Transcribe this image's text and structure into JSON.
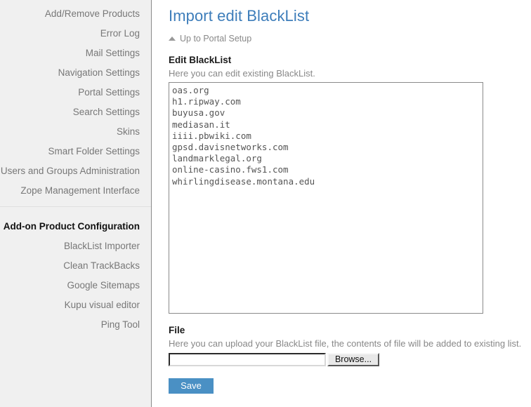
{
  "sidebar": {
    "sections": [
      {
        "name": "portal-setup-links",
        "items": [
          {
            "label": "Add/Remove Products",
            "current": false
          },
          {
            "label": "Error Log",
            "current": false
          },
          {
            "label": "Mail Settings",
            "current": false
          },
          {
            "label": "Navigation Settings",
            "current": false
          },
          {
            "label": "Portal Settings",
            "current": false
          },
          {
            "label": "Search Settings",
            "current": false
          },
          {
            "label": "Skins",
            "current": false
          },
          {
            "label": "Smart Folder Settings",
            "current": false
          },
          {
            "label": "Users and Groups Administration",
            "current": false
          },
          {
            "label": "Zope Management Interface",
            "current": false
          }
        ]
      },
      {
        "name": "addon-product-configuration",
        "items": [
          {
            "label": "Add-on Product Configuration",
            "current": true
          },
          {
            "label": "BlackList Importer",
            "current": false
          },
          {
            "label": "Clean TrackBacks",
            "current": false
          },
          {
            "label": "Google Sitemaps",
            "current": false
          },
          {
            "label": "Kupu visual editor",
            "current": false
          },
          {
            "label": "Ping Tool",
            "current": false
          }
        ]
      }
    ]
  },
  "main": {
    "title": "Import edit BlackList",
    "breadcrumb": {
      "icon": "up-arrow-icon",
      "label": "Up to Portal Setup"
    },
    "blacklist_field": {
      "label": "Edit BlackList",
      "help": "Here you can edit existing BlackList.",
      "value": "oas.org\nh1.ripway.com\nbuyusa.gov\nmediasan.it\niiii.pbwiki.com\ngpsd.davisnetworks.com\nlandmarklegal.org\nonline-casino.fws1.com\nwhirlingdisease.montana.edu"
    },
    "file_field": {
      "label": "File",
      "help": "Here you can upload your BlackList file, the contents of file will be added to existing list.",
      "path_value": "",
      "path_placeholder": "",
      "browse_label": "Browse..."
    },
    "save_label": "Save"
  },
  "colors": {
    "title_blue": "#3d7dba",
    "save_blue": "#4a90c4",
    "sidebar_bg": "#f0f0f0",
    "sidebar_link": "#777777"
  }
}
